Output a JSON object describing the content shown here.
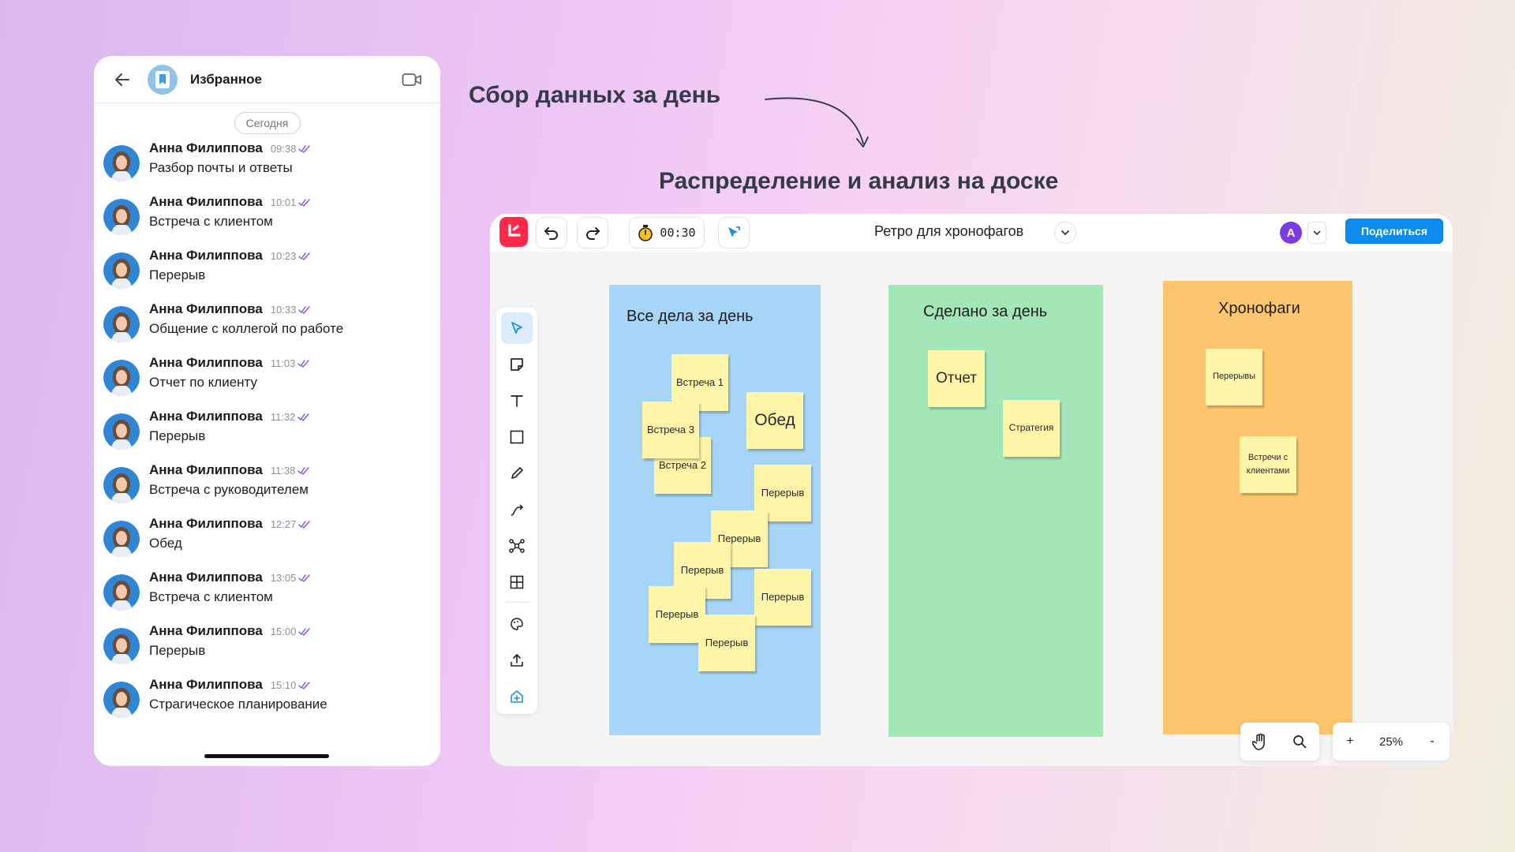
{
  "captions": {
    "collect": "Сбор данных за день",
    "distribute": "Распределение и анализ на доске"
  },
  "chat": {
    "title": "Избранное",
    "date_label": "Сегодня",
    "messages": [
      {
        "author": "Анна Филиппова",
        "time": "09:38",
        "text": "Разбор почты и ответы"
      },
      {
        "author": "Анна Филиппова",
        "time": "10:01",
        "text": "Встреча с клиентом"
      },
      {
        "author": "Анна Филиппова",
        "time": "10:23",
        "text": "Перерыв"
      },
      {
        "author": "Анна Филиппова",
        "time": "10:33",
        "text": "Общение с коллегой по работе"
      },
      {
        "author": "Анна Филиппова",
        "time": "11:03",
        "text": "Отчет по клиенту"
      },
      {
        "author": "Анна Филиппова",
        "time": "11:32",
        "text": "Перерыв"
      },
      {
        "author": "Анна Филиппова",
        "time": "11:38",
        "text": "Встреча с руководителем"
      },
      {
        "author": "Анна Филиппова",
        "time": "12:27",
        "text": "Обед"
      },
      {
        "author": "Анна Филиппова",
        "time": "13:05",
        "text": "Встреча с клиентом"
      },
      {
        "author": "Анна Филиппова",
        "time": "15:00",
        "text": "Перерыв"
      },
      {
        "author": "Анна Филиппова",
        "time": "15:10",
        "text": "Страгическое планирование"
      }
    ]
  },
  "board": {
    "timer": "00:30",
    "name": "Ретро для хронофагов",
    "user_initial": "А",
    "share_label": "Поделиться",
    "zoom": "25%",
    "zoom_in": "+",
    "zoom_out": "-",
    "colors": {
      "accent": "#0d8cf0",
      "logo": "#ff2a4a",
      "sticky": "#fff5a8",
      "col_all": "#a6d5f7",
      "col_done": "#a3e6b8",
      "col_chrono": "#fdc56d"
    },
    "columns": [
      {
        "title": "Все дела за день",
        "stickies": [
          {
            "text": "Встреча 2"
          },
          {
            "text": "Встреча 1"
          },
          {
            "text": "Встреча 3"
          },
          {
            "text": "Обед"
          },
          {
            "text": "Перерыв"
          },
          {
            "text": "Перерыв"
          },
          {
            "text": "Перерыв"
          },
          {
            "text": "Перерыв"
          },
          {
            "text": "Перерыв"
          },
          {
            "text": "Перерыв"
          }
        ]
      },
      {
        "title": "Сделано за день",
        "stickies": [
          {
            "text": "Отчет"
          },
          {
            "text": "Стратегия"
          }
        ]
      },
      {
        "title": "Хронофаги",
        "stickies": [
          {
            "text": "Перерывы"
          },
          {
            "text": "Встречи с клиентами"
          }
        ]
      }
    ]
  }
}
